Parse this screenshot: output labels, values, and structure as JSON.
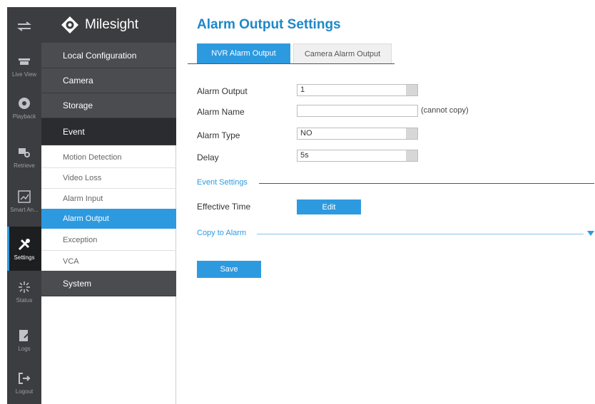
{
  "rail": [
    {
      "label": "",
      "icon": "swap-arrows-icon"
    },
    {
      "label": "Live View",
      "icon": "live-view-icon"
    },
    {
      "label": "Playback",
      "icon": "playback-icon"
    },
    {
      "label": "Retrieve",
      "icon": "retrieve-icon"
    },
    {
      "label": "Smart An...",
      "icon": "smart-analysis-icon"
    },
    {
      "label": "Settings",
      "icon": "settings-icon",
      "active": true
    },
    {
      "label": "Status",
      "icon": "status-icon"
    },
    {
      "label": "Logs",
      "icon": "logs-icon"
    },
    {
      "label": "Logout",
      "icon": "logout-icon"
    }
  ],
  "brand": "Milesight",
  "menu": {
    "local_configuration": "Local Configuration",
    "camera": "Camera",
    "storage": "Storage",
    "event": "Event",
    "event_items": [
      "Motion Detection",
      "Video Loss",
      "Alarm Input",
      "Alarm Output",
      "Exception",
      "VCA"
    ],
    "system": "System"
  },
  "page": {
    "title": "Alarm Output Settings",
    "tabs": [
      "NVR Alarm Output",
      "Camera Alarm Output"
    ],
    "alarm_output_label": "Alarm Output",
    "alarm_output_value": "1",
    "alarm_name_label": "Alarm Name",
    "alarm_name_value": "",
    "alarm_name_hint": "(cannot copy)",
    "alarm_type_label": "Alarm Type",
    "alarm_type_value": "NO",
    "delay_label": "Delay",
    "delay_value": "5s",
    "event_settings": "Event Settings",
    "effective_time_label": "Effective Time",
    "edit_button": "Edit",
    "copy_to_alarm": "Copy to Alarm",
    "save_button": "Save"
  },
  "colors": {
    "accent": "#2d9ae0",
    "rail_bg": "#3b3d40",
    "title": "#1e88c8"
  }
}
